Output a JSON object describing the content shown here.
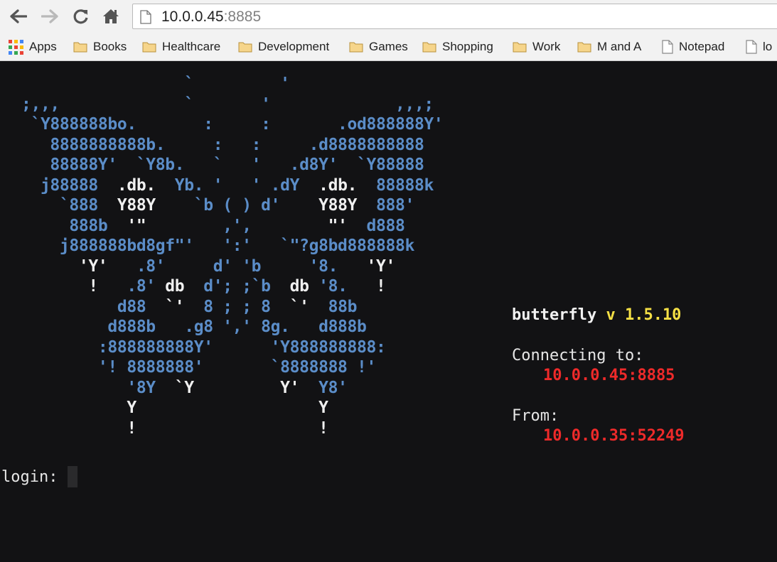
{
  "browser": {
    "url_host": "10.0.0.45",
    "url_port": ":8885",
    "nav": {
      "back": "back-arrow-icon",
      "forward": "forward-arrow-icon",
      "reload": "reload-icon",
      "home": "home-icon"
    }
  },
  "bookmarks": {
    "apps": "Apps",
    "items": [
      "Books",
      "Healthcare",
      "Development",
      "Games",
      "Shopping",
      "Work",
      "M and A",
      "Notepad",
      "lo"
    ]
  },
  "terminal": {
    "ascii_lines": [
      [
        [
          "b",
          "                   `         '"
        ]
      ],
      [
        [
          "b",
          "  ;,,,             `       '             ,,,;"
        ]
      ],
      [
        [
          "b",
          "   `Y888888bo.       :     :       .od888888Y'"
        ]
      ],
      [
        [
          "b",
          "     8888888888b.     :   :     .d8888888888"
        ]
      ],
      [
        [
          "b",
          "     88888Y'  `Y8b.   `   '   .d8Y'  `Y88888"
        ]
      ],
      [
        [
          "b",
          "    j88888  "
        ],
        [
          "w",
          ".db."
        ],
        [
          "b",
          "  Yb. '   ' .dY  "
        ],
        [
          "w",
          ".db."
        ],
        [
          "b",
          "  88888k"
        ]
      ],
      [
        [
          "b",
          "      `888  "
        ],
        [
          "w",
          "Y88Y"
        ],
        [
          "b",
          "    `b ( ) d'    "
        ],
        [
          "w",
          "Y88Y"
        ],
        [
          "b",
          "  888'"
        ]
      ],
      [
        [
          "b",
          "       888b  "
        ],
        [
          "w",
          "'\""
        ],
        [
          "b",
          "        ,',        "
        ],
        [
          "w",
          "\"'"
        ],
        [
          "b",
          "  d888"
        ]
      ],
      [
        [
          "b",
          "      j888888bd8gf\"'   ':'   `\"?g8bd888888k"
        ]
      ],
      [
        [
          "w",
          "        'Y'"
        ],
        [
          "b",
          "   .8'     d' 'b     '8.   "
        ],
        [
          "w",
          "'Y'"
        ]
      ],
      [
        [
          "w",
          "         !"
        ],
        [
          "b",
          "   .8' "
        ],
        [
          "w",
          "db"
        ],
        [
          "b",
          "  d'; ;`b  "
        ],
        [
          "w",
          "db"
        ],
        [
          "b",
          " '8.   "
        ],
        [
          "w",
          "!"
        ]
      ],
      [
        [
          "b",
          "            d88  "
        ],
        [
          "w",
          "`'"
        ],
        [
          "b",
          "  8 ; ; 8  "
        ],
        [
          "w",
          "`'"
        ],
        [
          "b",
          "  88b"
        ]
      ],
      [
        [
          "b",
          "           d888b   .g8 ',' 8g.   d888b"
        ]
      ],
      [
        [
          "b",
          "          :888888888Y'      'Y888888888:"
        ]
      ],
      [
        [
          "b",
          "          '! 8888888'       `8888888 !'"
        ]
      ],
      [
        [
          "b",
          "             '8Y  "
        ],
        [
          "w",
          "`Y"
        ],
        [
          "b",
          "         "
        ],
        [
          "w",
          "Y'"
        ],
        [
          "b",
          "  Y8'"
        ]
      ],
      [
        [
          "w",
          "             Y                   Y"
        ]
      ],
      [
        [
          "w",
          "             !                   !"
        ]
      ]
    ],
    "brand_name": "butterfly",
    "brand_version": "v 1.5.10",
    "connecting_label": "Connecting to:",
    "connecting_addr": "10.0.0.45:8885",
    "from_label": "From:",
    "from_addr": "10.0.0.35:52249",
    "prompt": "login:"
  },
  "colors": {
    "terminal_bg": "#121214",
    "ascii_blue": "#5b8dc8",
    "ascii_white": "#f0f0f0",
    "version_yellow": "#f5e045",
    "address_red": "#ee2a2a"
  }
}
